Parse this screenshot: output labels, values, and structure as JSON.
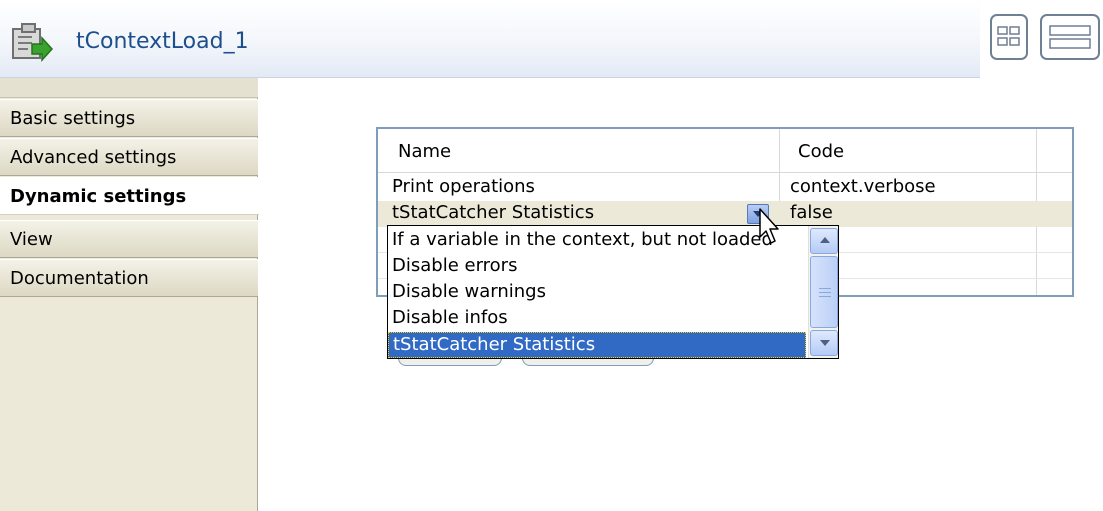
{
  "window": {
    "title": "tContextLoad_1"
  },
  "tabs": [
    {
      "label": "Basic settings",
      "active": false
    },
    {
      "label": "Advanced settings",
      "active": false
    },
    {
      "label": "Dynamic settings",
      "active": true
    },
    {
      "label": "View",
      "active": false
    },
    {
      "label": "Documentation",
      "active": false
    }
  ],
  "table": {
    "columns": [
      "Name",
      "Code"
    ],
    "rows": [
      {
        "name": "Print operations",
        "code": "context.verbose"
      },
      {
        "name": "tStatCatcher Statistics",
        "code": "false"
      }
    ]
  },
  "dropdown": {
    "options": [
      "If a variable in the context, but not loaded",
      "Disable errors",
      "Disable warnings",
      "Disable infos",
      "tStatCatcher Statistics"
    ],
    "selected": "tStatCatcher Statistics"
  },
  "icons": {
    "component": "context-load-icon",
    "layout_toggle": "layout-grid-icon",
    "layout_rows": "layout-rows-icon",
    "dropdown_arrow": "chevron-down-icon",
    "cursor": "mouse-pointer-icon"
  },
  "colors": {
    "title": "#1d4f8c",
    "selection": "#316ac5",
    "tab_strip": "#ece9d8",
    "table_border": "#7f9db9"
  }
}
